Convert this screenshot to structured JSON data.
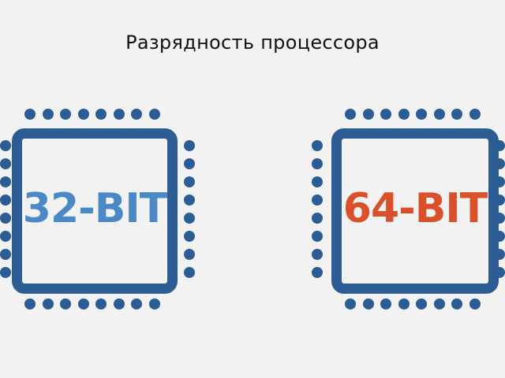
{
  "page": {
    "title": "Разрядность процессора"
  },
  "chips": [
    {
      "label": "32-BIT",
      "color": "#4a88c6"
    },
    {
      "label": "64-BIT",
      "color": "#d9502a"
    }
  ],
  "colors": {
    "chip_border": "#2b5c93",
    "background": "#f2f2f2"
  }
}
